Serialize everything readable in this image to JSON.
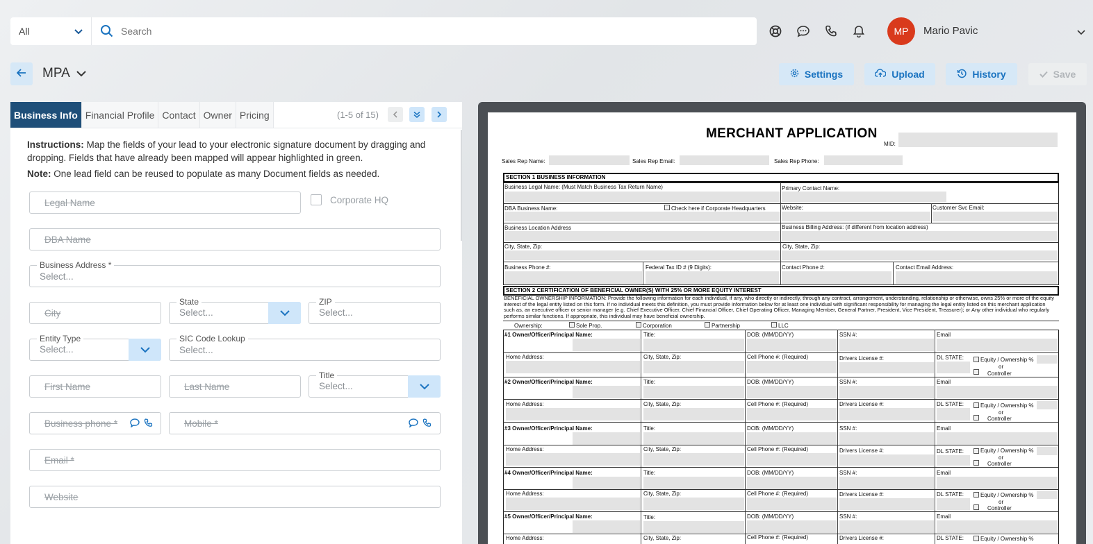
{
  "header": {
    "scope_select": "All",
    "search_placeholder": "Search",
    "user_initials": "MP",
    "user_name": "Mario Pavic",
    "avatar_color": "#d93a1c"
  },
  "toolbar": {
    "doc_title": "MPA",
    "settings_label": "Settings",
    "upload_label": "Upload",
    "history_label": "History",
    "save_label": "Save"
  },
  "tabs": [
    "Business Info",
    "Financial Profile",
    "Contact",
    "Owner",
    "Pricing"
  ],
  "pagination": "(1-5 of 15)",
  "instructions": {
    "lead": "Instructions:",
    "text": " Map the fields of your lead to your electronic signature document by dragging and dropping. Fields that have already been mapped will appear highlighted in green.",
    "note_lead": "Note:",
    "note_text": " One lead field can be reused to populate as many Document fields as needed."
  },
  "form": {
    "legal_name": "Legal Name",
    "corporate_hq": "Corporate HQ",
    "dba_name": "DBA Name",
    "business_address_label": "Business Address *",
    "select_placeholder": "Select...",
    "city": "City",
    "state_label": "State",
    "zip_label": "ZIP",
    "entity_type_label": "Entity Type",
    "sic_label": "SIC Code Lookup",
    "first_name": "First Name",
    "last_name": "Last Name",
    "title_label": "Title",
    "business_phone": "Business phone *",
    "mobile": "Mobile *",
    "email": "Email *",
    "website": "Website"
  },
  "document": {
    "title": "MERCHANT APPLICATION",
    "mid": "MID:",
    "rep_name": "Sales Rep Name:",
    "rep_email": "Sales Rep Email:",
    "rep_phone": "Sales Rep Phone:",
    "section1": "SECTION 1      BUSINESS INFORMATION",
    "legal_name": "Business Legal Name: (Must Match Business Tax Return Name)",
    "primary_contact": "Primary Contact Name:",
    "dba": "DBA Business Name:",
    "corp_hq_check": "Check here if Corporate Headquarters",
    "website": "Website:",
    "cs_email": "Customer Svc Email:",
    "location_address": "Business Location Address",
    "billing_address": "Business Billing Address: (if different from location address)",
    "city_state_zip_1": "City, State, Zip:",
    "city_state_zip_2": "City, State, Zip:",
    "business_phone": "Business Phone #:",
    "federal_tax": "Federal Tax ID # (9 Digits):",
    "contact_phone": "Contact Phone #:",
    "contact_email": "Contact Email Address:",
    "section2": "SECTION 2      CERTIFICATION OF BENEFICIAL OWNER(S) WITH 25% OR MORE EQUITY INTEREST",
    "beneficial_text": "BENEFICIAL OWNERSHIP INFORMATION: Provide the following information for each individual, if any, who directly or indirectly, through any contract, arrangement, understanding, relationship or otherwise, owns 25% or more of the equity interest of the legal entity listed on this form. If no individual meets this definition, you must provide information below for at least one individual with significant responsibility for managing the legal entity listed on this merchant application such as, an executive officer or senior manager (e.g. Chief Executive Officer, Chief Financial Officer, Chief Operating Officer, Managing Member, General Partner, President, Vice President, Treasurer); or Any other individual who regularly performs similar functions. If appropriate, this individual may have beneficial ownership.",
    "ownership": "Ownership:",
    "ownership_options": [
      "Sole Prop.",
      "Corporation",
      "Partnership",
      "LLC"
    ],
    "owners": [
      {
        "label": "#1 Owner/Officer/Principal Name:"
      },
      {
        "label": "#2 Owner/Officer/Principal Name:"
      },
      {
        "label": "#3 Owner/Officer/Principal Name:"
      },
      {
        "label": "#4 Owner/Officer/Principal Name:"
      },
      {
        "label": "#5 Owner/Officer/Principal Name:"
      }
    ],
    "title_col": "Title:",
    "dob_col": "DOB: (MM/DD/YY)",
    "ssn_col": "SSN #:",
    "email_col": "Email",
    "home_address": "Home Address:",
    "city_state_zip": "City, State, Zip:",
    "cell_phone": "Cell Phone #: (Required)",
    "drivers_license": "Drivers License #:",
    "dl_state": "DL STATE:",
    "equity": "Equity / Ownership %",
    "or": "or",
    "controller": "Controller"
  }
}
